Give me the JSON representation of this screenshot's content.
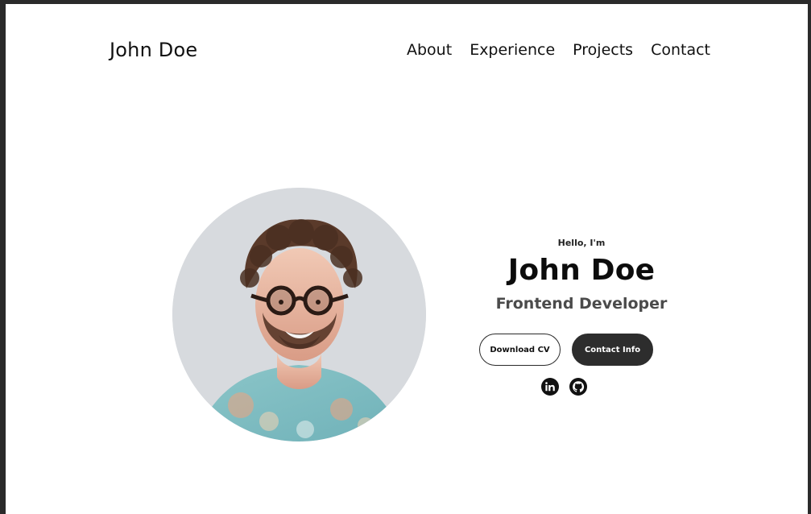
{
  "nav": {
    "logo": "John Doe",
    "links": [
      "About",
      "Experience",
      "Projects",
      "Contact"
    ]
  },
  "hero": {
    "greeting": "Hello, I'm",
    "name": "John Doe",
    "role": "Frontend Developer",
    "buttons": {
      "download_cv": "Download CV",
      "contact_info": "Contact Info"
    },
    "icons": {
      "linkedin": "linkedin-icon",
      "github": "github-icon"
    }
  },
  "colors": {
    "border": "#2a2a2a",
    "text": "#111111",
    "role_text": "#4b4b4b",
    "button_dark_bg": "#2d2d2d",
    "button_dark_text": "#ffffff"
  }
}
